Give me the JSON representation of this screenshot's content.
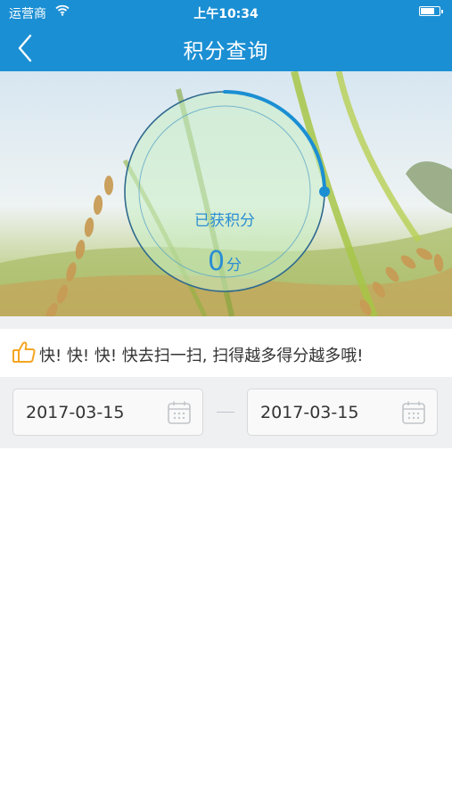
{
  "status_bar": {
    "carrier": "运营商",
    "time": "上午10:34"
  },
  "nav": {
    "title": "积分查询",
    "back_icon": "chevron-left-icon"
  },
  "score": {
    "label": "已获积分",
    "value": "0",
    "unit": "分",
    "progress": 0.25
  },
  "tip": {
    "icon": "thumbs-up-icon",
    "text": "快! 快! 快! 快去扫一扫, 扫得越多得分越多哦!"
  },
  "date_range": {
    "start": "2017-03-15",
    "end": "2017-03-15",
    "icon": "calendar-icon"
  },
  "colors": {
    "primary": "#1b8fd3",
    "accent_text": "#2a8ed2",
    "tip_icon": "#f5a623",
    "band": "#eef0f2"
  }
}
